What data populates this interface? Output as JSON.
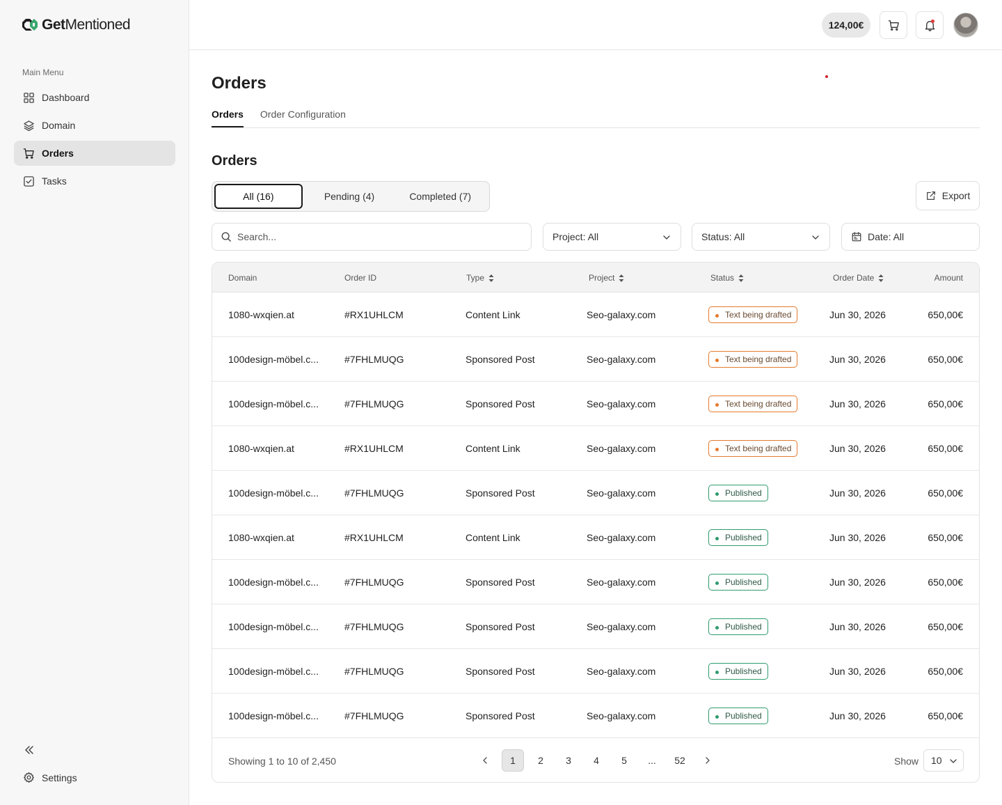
{
  "app": {
    "logo_text_bold": "Get",
    "logo_text_regular": "Mentioned"
  },
  "sidebar": {
    "menu_title": "Main Menu",
    "items": [
      {
        "label": "Dashboard",
        "icon": "grid-icon",
        "active": false
      },
      {
        "label": "Domain",
        "icon": "layers-icon",
        "active": false
      },
      {
        "label": "Orders",
        "icon": "cart-icon",
        "active": true
      },
      {
        "label": "Tasks",
        "icon": "checkbox-icon",
        "active": false
      }
    ],
    "settings_label": "Settings"
  },
  "topbar": {
    "balance": "124,00€"
  },
  "page": {
    "title": "Orders",
    "tabs": [
      "Orders",
      "Order Configuration"
    ],
    "active_tab": "Orders",
    "section_title": "Orders"
  },
  "filters": {
    "segments": [
      "All (16)",
      "Pending (4)",
      "Completed (7)"
    ],
    "export_label": "Export",
    "search_placeholder": "Search...",
    "project": "Project: All",
    "status": "Status: All",
    "date": "Date: All"
  },
  "table": {
    "columns": [
      "Domain",
      "Order ID",
      "Type",
      "Project",
      "Status",
      "Order Date",
      "Amount"
    ],
    "rows": [
      {
        "domain": "1080-wxqien.at",
        "order_id": "#RX1UHLCM",
        "type": "Content Link",
        "project": "Seo-galaxy.com",
        "status": "Text being drafted",
        "status_kind": "drafted",
        "date": "Jun 30, 2026",
        "amount": "650,00€"
      },
      {
        "domain": "100design-möbel.c...",
        "order_id": "#7FHLMUQG",
        "type": "Sponsored Post",
        "project": "Seo-galaxy.com",
        "status": "Text being drafted",
        "status_kind": "drafted",
        "date": "Jun 30, 2026",
        "amount": "650,00€"
      },
      {
        "domain": "100design-möbel.c...",
        "order_id": "#7FHLMUQG",
        "type": "Sponsored Post",
        "project": "Seo-galaxy.com",
        "status": "Text being drafted",
        "status_kind": "drafted",
        "date": "Jun 30, 2026",
        "amount": "650,00€"
      },
      {
        "domain": "1080-wxqien.at",
        "order_id": "#RX1UHLCM",
        "type": "Content Link",
        "project": "Seo-galaxy.com",
        "status": "Text being drafted",
        "status_kind": "drafted",
        "date": "Jun 30, 2026",
        "amount": "650,00€"
      },
      {
        "domain": "100design-möbel.c...",
        "order_id": "#7FHLMUQG",
        "type": "Sponsored Post",
        "project": "Seo-galaxy.com",
        "status": "Published",
        "status_kind": "published",
        "date": "Jun 30, 2026",
        "amount": "650,00€"
      },
      {
        "domain": "1080-wxqien.at",
        "order_id": "#RX1UHLCM",
        "type": "Content Link",
        "project": "Seo-galaxy.com",
        "status": "Published",
        "status_kind": "published",
        "date": "Jun 30, 2026",
        "amount": "650,00€"
      },
      {
        "domain": "100design-möbel.c...",
        "order_id": "#7FHLMUQG",
        "type": "Sponsored Post",
        "project": "Seo-galaxy.com",
        "status": "Published",
        "status_kind": "published",
        "date": "Jun 30, 2026",
        "amount": "650,00€"
      },
      {
        "domain": "100design-möbel.c...",
        "order_id": "#7FHLMUQG",
        "type": "Sponsored Post",
        "project": "Seo-galaxy.com",
        "status": "Published",
        "status_kind": "published",
        "date": "Jun 30, 2026",
        "amount": "650,00€"
      },
      {
        "domain": "100design-möbel.c...",
        "order_id": "#7FHLMUQG",
        "type": "Sponsored Post",
        "project": "Seo-galaxy.com",
        "status": "Published",
        "status_kind": "published",
        "date": "Jun 30, 2026",
        "amount": "650,00€"
      },
      {
        "domain": "100design-möbel.c...",
        "order_id": "#7FHLMUQG",
        "type": "Sponsored Post",
        "project": "Seo-galaxy.com",
        "status": "Published",
        "status_kind": "published",
        "date": "Jun 30, 2026",
        "amount": "650,00€"
      }
    ]
  },
  "pagination": {
    "showing": "Showing 1 to 10 of 2,450",
    "pages": [
      "1",
      "2",
      "3",
      "4",
      "5",
      "...",
      "52"
    ],
    "current": "1",
    "show_label": "Show",
    "page_size": "10"
  },
  "colors": {
    "accent_green": "#2e9b6e",
    "drafted_orange": "#e57a2c",
    "notification_red": "#e23b3b"
  }
}
